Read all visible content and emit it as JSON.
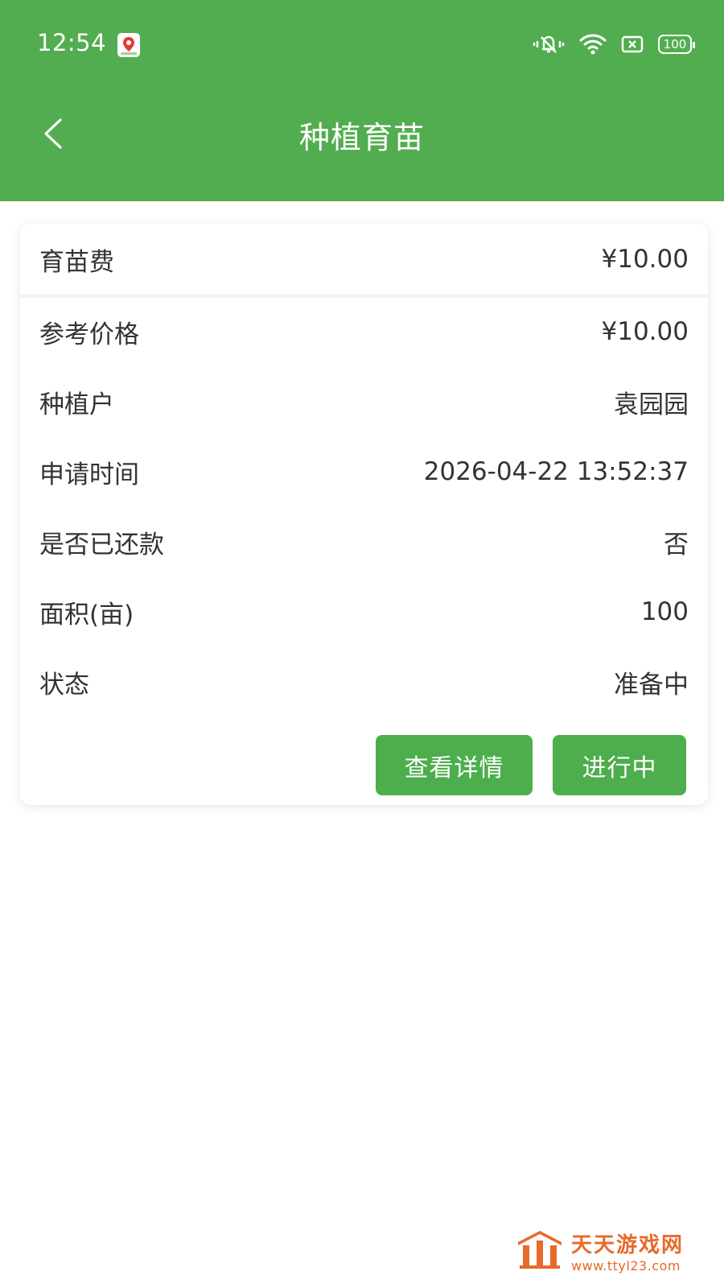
{
  "status_bar": {
    "time": "12:54",
    "battery": "100",
    "icons": [
      "map-pin-app-icon",
      "vibrate-mute-icon",
      "wifi-icon",
      "sim-off-icon",
      "battery-icon"
    ]
  },
  "nav": {
    "title": "种植育苗",
    "back_icon": "chevron-left-icon"
  },
  "card": {
    "rows": [
      {
        "label": "育苗费",
        "value": "¥10.00"
      },
      {
        "label": "参考价格",
        "value": "¥10.00"
      },
      {
        "label": "种植户",
        "value": "袁园园"
      },
      {
        "label": "申请时间",
        "value": "2026-04-22 13:52:37"
      },
      {
        "label": "是否已还款",
        "value": "否"
      },
      {
        "label": "面积(亩)",
        "value": "100"
      },
      {
        "label": "状态",
        "value": "准备中"
      }
    ],
    "buttons": {
      "detail": "查看详情",
      "in_progress": "进行中"
    }
  },
  "watermark": {
    "title": "天天游戏网",
    "url": "www.ttyl23.com"
  },
  "colors": {
    "primary_green": "#52ad50",
    "button_green": "#4cae4c",
    "watermark_orange": "#e8692b"
  }
}
